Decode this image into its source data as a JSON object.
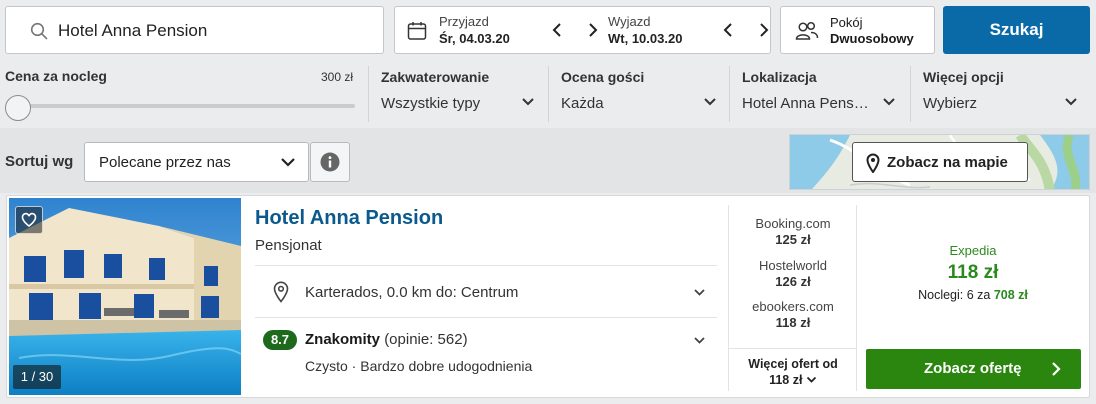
{
  "search": {
    "value": "Hotel Anna Pension"
  },
  "dates": {
    "checkin_label": "Przyjazd",
    "checkin_value": "Śr, 04.03.20",
    "checkout_label": "Wyjazd",
    "checkout_value": "Wt, 10.03.20"
  },
  "room": {
    "label": "Pokój",
    "value": "Dwuosobowy"
  },
  "search_button": "Szukaj",
  "filters": {
    "price": {
      "label": "Cena za nocleg",
      "max": "300 zł",
      "level": 0
    },
    "accommodation": {
      "title": "Zakwaterowanie",
      "value": "Wszystkie typy"
    },
    "rating": {
      "title": "Ocena gości",
      "value": "Każda"
    },
    "location": {
      "title": "Lokalizacja",
      "value": "Hotel Anna Pens…"
    },
    "more": {
      "title": "Więcej opcji",
      "value": "Wybierz"
    }
  },
  "sort": {
    "label": "Sortuj wg",
    "value": "Polecane przez nas"
  },
  "map_button": "Zobacz na mapie",
  "hotel": {
    "name": "Hotel Anna Pension",
    "type": "Pensjonat",
    "photo_counter": "1 / 30",
    "location": "Karterados, 0.0 km do: Centrum",
    "score": "8.7",
    "rating_word": "Znakomity",
    "reviews": "(opinie: 562)",
    "amenities": "Czysto · Bardzo dobre udogodnienia"
  },
  "providers": [
    {
      "name": "Booking.com",
      "price": "125 zł"
    },
    {
      "name": "Hostelworld",
      "price": "126 zł"
    },
    {
      "name": "ebookers.com",
      "price": "118 zł"
    }
  ],
  "more_offers": {
    "line1": "Więcej ofert od",
    "line2": "118 zł"
  },
  "best_offer": {
    "site": "Expedia",
    "price": "118 zł",
    "nights_prefix": "Noclegi: 6 za",
    "total": "708 zł",
    "button": "Zobacz ofertę"
  }
}
